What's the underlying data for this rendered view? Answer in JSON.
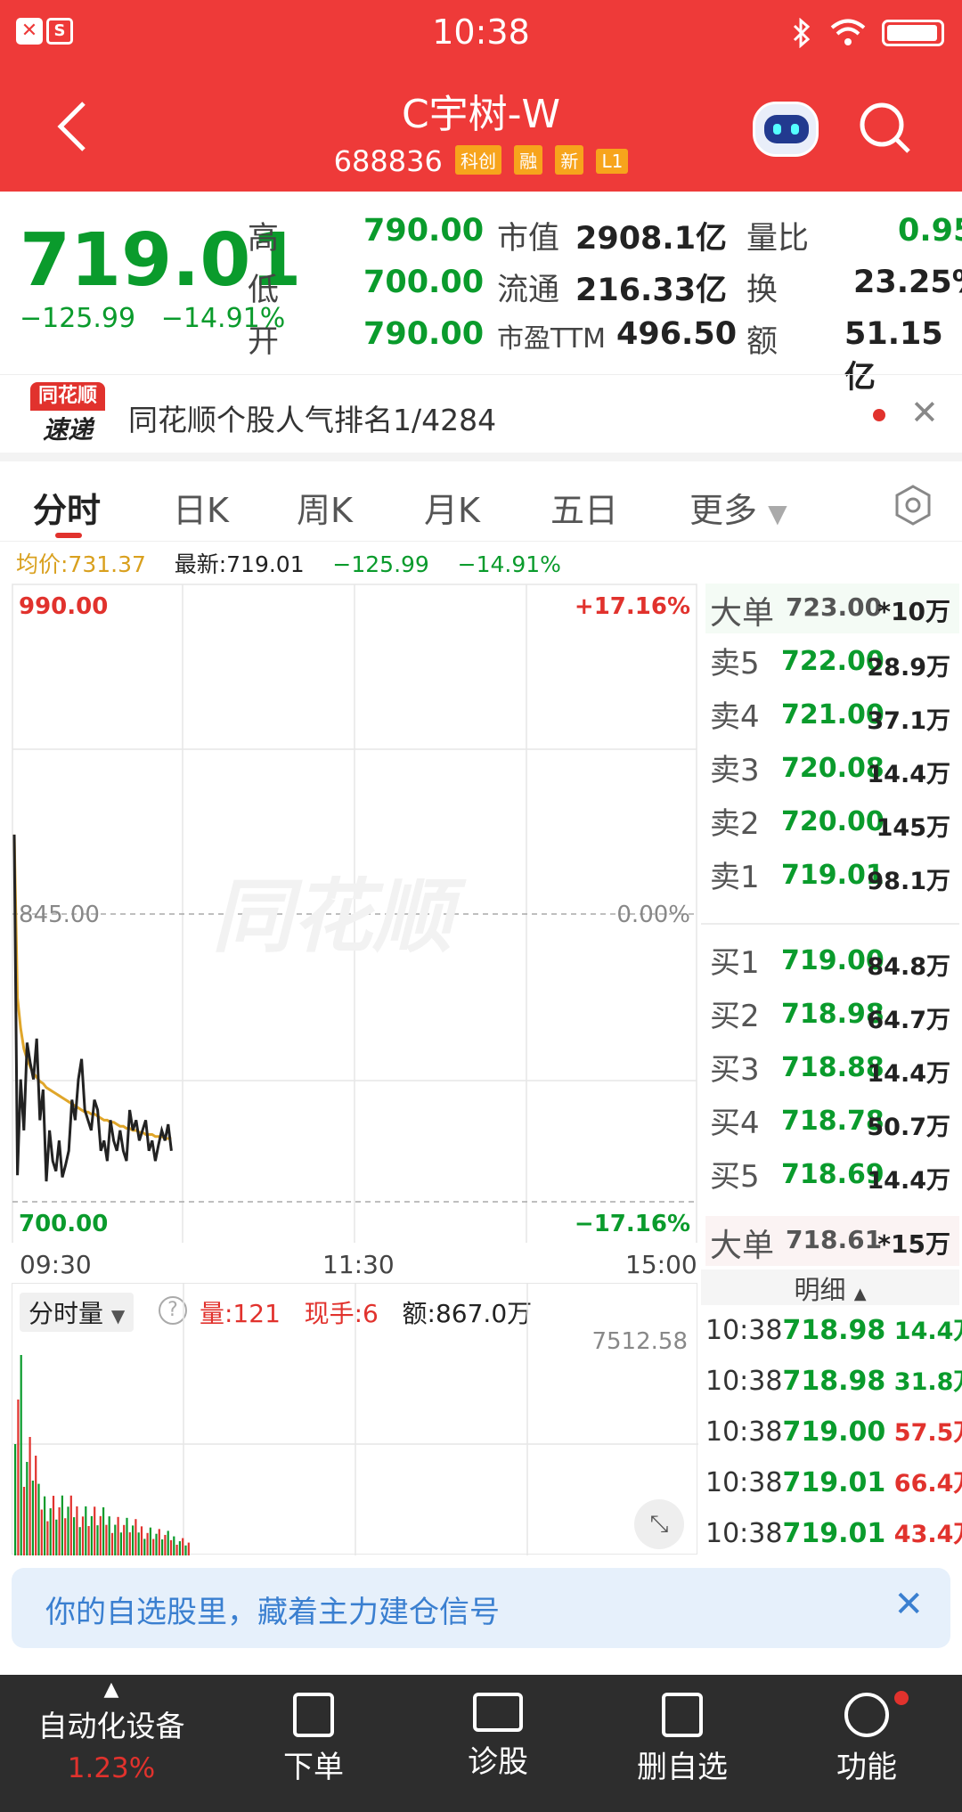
{
  "status_bar": {
    "time": "10:38"
  },
  "header": {
    "title": "C宇树-W",
    "code": "688836",
    "tags": [
      "科创",
      "融",
      "新",
      "L1"
    ]
  },
  "quote": {
    "price": "719.01",
    "change": "−125.99",
    "change_pct": "−14.91%",
    "high_label": "高",
    "high": "790.00",
    "low_label": "低",
    "low": "700.00",
    "open_label": "开",
    "open": "790.00",
    "mcap_label": "市值",
    "mcap": "2908.1亿",
    "float_label": "流通",
    "float": "216.33亿",
    "pe_label": "市盈TTM",
    "pe": "496.50",
    "vr_label": "量比",
    "vr": "0.95",
    "turn_label": "换",
    "turn": "23.25%",
    "amt_label": "额",
    "amt": "51.15亿"
  },
  "banner": {
    "logo_top": "同花顺",
    "logo_bottom": "速递",
    "text": "同花顺个股人气排名1/4284"
  },
  "tabs": [
    "分时",
    "日K",
    "周K",
    "月K",
    "五日",
    "更多"
  ],
  "info": {
    "avg_label": "均价:731.37",
    "latest_label": "最新:719.01",
    "chg": "−125.99",
    "pct": "−14.91%"
  },
  "chart_labels": {
    "top": "990.00",
    "top_pct": "+17.16%",
    "mid": "845.00",
    "mid_pct": "0.00%",
    "bot": "700.00",
    "bot_pct": "−17.16%",
    "t1": "09:30",
    "t2": "11:30",
    "t3": "15:00",
    "watermark": "同花顺"
  },
  "volume_panel": {
    "selector": "分时量",
    "vol": "量:121",
    "hand": "现手:6",
    "amt": "额:867.0万",
    "max": "7512.58"
  },
  "orderbook": {
    "big_sell": {
      "label": "大单",
      "price": "723.00",
      "size": "*10万"
    },
    "sells": [
      {
        "label": "卖5",
        "price": "722.00",
        "size": "28.9万"
      },
      {
        "label": "卖4",
        "price": "721.00",
        "size": "37.1万"
      },
      {
        "label": "卖3",
        "price": "720.08",
        "size": "14.4万"
      },
      {
        "label": "卖2",
        "price": "720.00",
        "size": "145万"
      },
      {
        "label": "卖1",
        "price": "719.01",
        "size": "98.1万"
      }
    ],
    "buys": [
      {
        "label": "买1",
        "price": "719.00",
        "size": "84.8万"
      },
      {
        "label": "买2",
        "price": "718.98",
        "size": "64.7万"
      },
      {
        "label": "买3",
        "price": "718.88",
        "size": "14.4万"
      },
      {
        "label": "买4",
        "price": "718.78",
        "size": "50.7万"
      },
      {
        "label": "买5",
        "price": "718.69",
        "size": "14.4万"
      }
    ],
    "big_buy": {
      "label": "大单",
      "price": "718.61",
      "size": "*15万"
    },
    "detail_label": "明细",
    "details": [
      {
        "time": "10:38",
        "price": "718.98",
        "size": "14.4万"
      },
      {
        "time": "10:38",
        "price": "718.98",
        "size": "31.8万"
      },
      {
        "time": "10:38",
        "price": "719.00",
        "size": "57.5万"
      },
      {
        "time": "10:38",
        "price": "719.01",
        "size": "66.4万"
      },
      {
        "time": "10:38",
        "price": "719.01",
        "size": "43.4万"
      }
    ]
  },
  "alert": {
    "text": "你的自选股里，藏着主力建仓信号"
  },
  "bottom_nav": {
    "sector": "自动化设备",
    "sector_pct": "1.23%",
    "items": [
      "下单",
      "诊股",
      "删自选",
      "功能"
    ]
  },
  "chart_data": {
    "type": "line",
    "ylim": [
      700,
      990
    ],
    "price": [
      880,
      713,
      760,
      735,
      778,
      768,
      760,
      780,
      740,
      755,
      710,
      735,
      720,
      715,
      730,
      712,
      718,
      725,
      750,
      740,
      760,
      770,
      745,
      740,
      735,
      750,
      745,
      725,
      730,
      720,
      740,
      730,
      725,
      735,
      725,
      720,
      745,
      735,
      740,
      730,
      735,
      740,
      725,
      730,
      720,
      728,
      735,
      730,
      738,
      725
    ],
    "avg": [
      880,
      800,
      785,
      775,
      770,
      766,
      763,
      761,
      759,
      758,
      756,
      755,
      754,
      753,
      752,
      751,
      750,
      749,
      748,
      747,
      746,
      745,
      744,
      744,
      743,
      743,
      742,
      741,
      740,
      740,
      739,
      739,
      738,
      737,
      737,
      736,
      736,
      735,
      735,
      734,
      734,
      733,
      733,
      733,
      732,
      732,
      732,
      731,
      731,
      731
    ]
  }
}
